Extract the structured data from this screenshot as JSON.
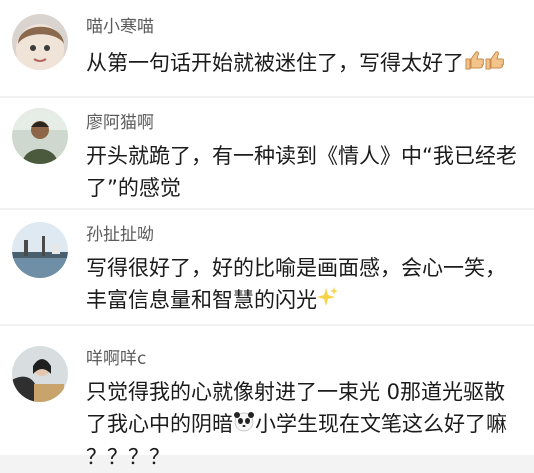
{
  "comments": [
    {
      "name": "喵小寒喵",
      "lines": [
        "从第一句话开始就被迷住了，写得太好了"
      ],
      "trailing_emoji": "thumbs-up-icon x2"
    },
    {
      "name": "廖阿猫啊",
      "lines": [
        "开头就跪了，有一种读到《情人》中“我已经老",
        "了”的感觉"
      ]
    },
    {
      "name": "孙扯扯呦",
      "lines": [
        "写得很好了，好的比喻是画面感，会心一笑，",
        "丰富信息量和智慧的闪光"
      ],
      "trailing_emoji": "sparkles-icon"
    },
    {
      "name": "咩啊咩c",
      "lines": [
        "只觉得我的心就像射进了一束光 0那道光驱散",
        "了我心中的阴暗",
        "小学生现在文笔这么好了嘛",
        "？？？？"
      ],
      "inline_emoji": "panda-icon"
    }
  ],
  "colors": {
    "background": "#f3f3f3",
    "card": "#ffffff",
    "name": "#5c5c5c",
    "text": "#1b1b1b"
  }
}
